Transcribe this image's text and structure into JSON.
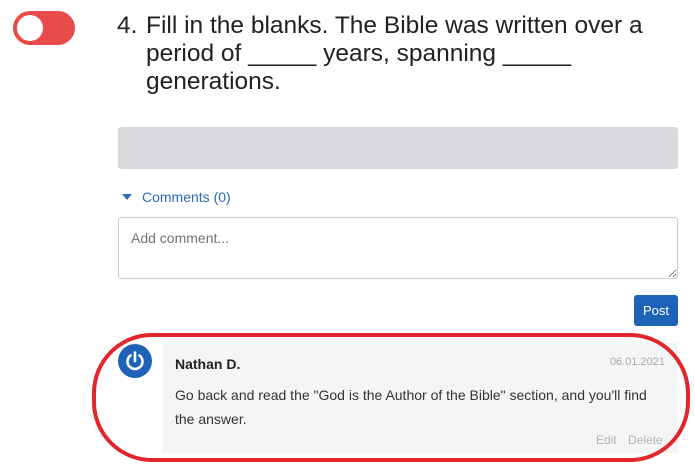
{
  "toggle": {
    "state": "off",
    "color": "#e94b4b"
  },
  "question": {
    "number": "4.",
    "lines": [
      "Fill in the blanks. The Bible was written over a",
      "period of _____ years, spanning _____",
      "generations."
    ]
  },
  "comments": {
    "toggle_label": "Comments (0)",
    "input_placeholder": "Add comment...",
    "post_label": "Post",
    "items": [
      {
        "author": "Nathan D.",
        "date": "06.01.2021",
        "body": "Go back and read the \"God is the Author of the Bible\" section, and you'll find the answer.",
        "edit_label": "Edit",
        "delete_label": "Delete",
        "avatar_icon": "power-icon"
      }
    ]
  },
  "colors": {
    "accent": "#1f63b8",
    "highlight": "#e2262b"
  }
}
